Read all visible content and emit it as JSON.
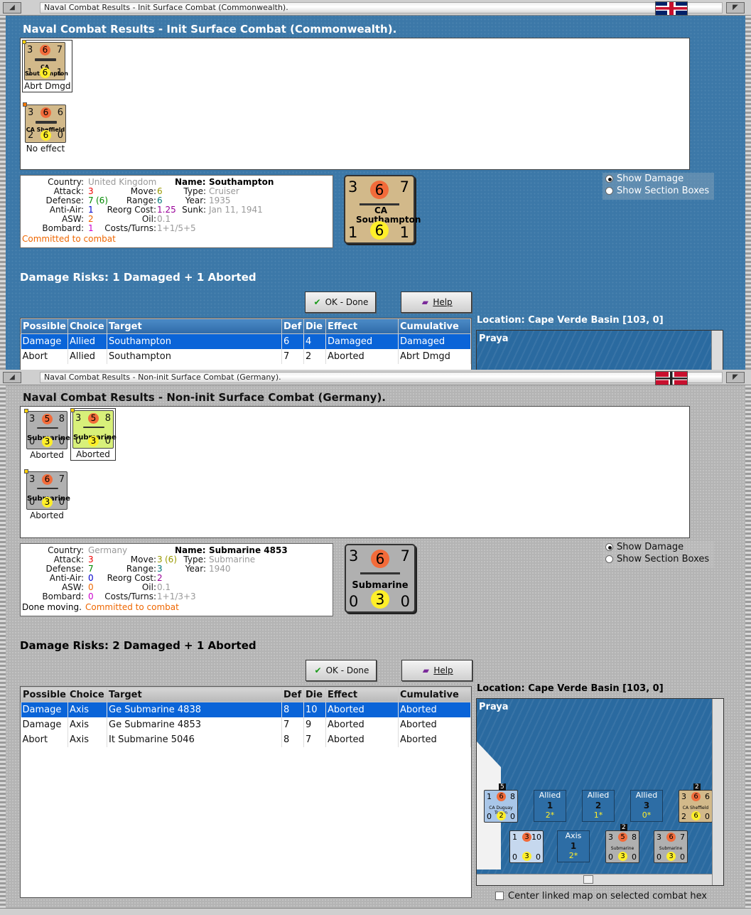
{
  "top": {
    "titlebar": "Naval Combat Results - Init Surface Combat (Commonwealth).",
    "heading": "Naval Combat Results - Init Surface Combat (Commonwealth).",
    "units": [
      {
        "tl": "3",
        "tc": "6",
        "tr": "7",
        "name": "CA Southampton",
        "bl": "1",
        "bc": "6",
        "br": "1",
        "label": "Abrt Dmgd"
      },
      {
        "tl": "3",
        "tc": "6",
        "tr": "6",
        "name": "CA Sheffield",
        "bl": "2",
        "bc": "6",
        "br": "0",
        "label": "No effect"
      }
    ],
    "info": {
      "country_label": "Country:",
      "country": "United Kingdom",
      "attack_label": "Attack:",
      "attack": "3",
      "defense_label": "Defense:",
      "defense": "7",
      "defense_extra": "(6)",
      "antiair_label": "Anti-Air:",
      "antiair": "1",
      "asw_label": "ASW:",
      "asw": "2",
      "bombard_label": "Bombard:",
      "bombard": "1",
      "status": "Committed to combat",
      "name_label": "Name:",
      "name": "Southampton",
      "move_label": "Move:",
      "move": "6",
      "type_label": "Type:",
      "type": "Cruiser",
      "range_label": "Range:",
      "range": "6",
      "year_label": "Year:",
      "year": "1935",
      "reorg_label": "Reorg Cost:",
      "reorg": "1.25",
      "sunk_label": "Sunk:",
      "sunk": "Jan 11, 1941",
      "oil_label": "Oil:",
      "oil": "0.1",
      "costs_label": "Costs/Turns:",
      "costs": "1+1/5+5"
    },
    "bigcounter": {
      "tl": "3",
      "tc": "6",
      "tr": "7",
      "name": "CA Southampton",
      "bl": "1",
      "bc": "6",
      "br": "1"
    },
    "radio": {
      "opt1": "Show Damage",
      "opt2": "Show Section Boxes"
    },
    "risks": "Damage Risks:  1 Damaged + 1 Aborted",
    "ok": "OK - Done",
    "help": "Help",
    "table": {
      "headers": [
        "Possible",
        "Choice",
        "Target",
        "Def",
        "Die",
        "Effect",
        "Cumulative"
      ],
      "rows": [
        [
          "Damage",
          "Allied",
          "Southampton",
          "6",
          "4",
          "Damaged",
          "Damaged"
        ],
        [
          "Abort",
          "Allied",
          "Southampton",
          "7",
          "2",
          "Aborted",
          "Abrt Dmgd"
        ]
      ]
    },
    "location": "Location:  Cape Verde Basin [103, 0]",
    "map_place": "Praya"
  },
  "bottom": {
    "titlebar": "Naval Combat Results - Non-init Surface Combat (Germany).",
    "heading": "Naval Combat Results - Non-init Surface Combat (Germany).",
    "units": [
      {
        "tl": "3",
        "tc": "5",
        "tr": "8",
        "name": "Submarine",
        "bl": "0",
        "bc": "3",
        "br": "0",
        "label": "Aborted"
      },
      {
        "tl": "3",
        "tc": "5",
        "tr": "8",
        "name": "Submarine",
        "bl": "0",
        "bc": "3",
        "br": "0",
        "label": "Aborted"
      },
      {
        "tl": "3",
        "tc": "6",
        "tr": "7",
        "name": "Submarine",
        "bl": "0",
        "bc": "3",
        "br": "0",
        "label": "Aborted"
      }
    ],
    "info": {
      "country_label": "Country:",
      "country": "Germany",
      "attack_label": "Attack:",
      "attack": "3",
      "defense_label": "Defense:",
      "defense": "7",
      "antiair_label": "Anti-Air:",
      "antiair": "0",
      "asw_label": "ASW:",
      "asw": "0",
      "bombard_label": "Bombard:",
      "bombard": "0",
      "status1": "Done moving.",
      "status2": "Committed to combat",
      "name_label": "Name:",
      "name": "Submarine 4853",
      "move_label": "Move:",
      "move": "3",
      "move_extra": "(6)",
      "type_label": "Type:",
      "type": "Submarine",
      "range_label": "Range:",
      "range": "3",
      "year_label": "Year:",
      "year": "1940",
      "reorg_label": "Reorg Cost:",
      "reorg": "2",
      "oil_label": "Oil:",
      "oil": "0.1",
      "costs_label": "Costs/Turns:",
      "costs": "1+1/3+3"
    },
    "bigcounter": {
      "tl": "3",
      "tc": "6",
      "tr": "7",
      "name": "Submarine",
      "bl": "0",
      "bc": "3",
      "br": "0"
    },
    "radio": {
      "opt1": "Show Damage",
      "opt2": "Show Section Boxes"
    },
    "risks": "Damage Risks:  2 Damaged + 1 Aborted",
    "ok": "OK - Done",
    "help": "Help",
    "table": {
      "headers": [
        "Possible",
        "Choice",
        "Target",
        "Def",
        "Die",
        "Effect",
        "Cumulative"
      ],
      "rows": [
        [
          "Damage",
          "Axis",
          "Ge Submarine 4838",
          "8",
          "10",
          "Aborted",
          "Aborted"
        ],
        [
          "Damage",
          "Axis",
          "Ge Submarine 4853",
          "7",
          "9",
          "Aborted",
          "Aborted"
        ],
        [
          "Abort",
          "Axis",
          "It Submarine 5046",
          "8",
          "7",
          "Aborted",
          "Aborted"
        ]
      ]
    },
    "location": "Location:  Cape Verde Basin [103, 0]",
    "map_place": "Praya",
    "map": {
      "c1": {
        "stack": "5",
        "tl": "1",
        "tc": "6",
        "tr": "8",
        "name": "CA Duguay Trouin",
        "bl": "0",
        "bc": "2",
        "br": "0"
      },
      "boxes": [
        {
          "side": "Allied",
          "num": "1",
          "val": "2*"
        },
        {
          "side": "Allied",
          "num": "2",
          "val": "1*"
        },
        {
          "side": "Allied",
          "num": "3",
          "val": "0*"
        },
        {
          "side": "Axis",
          "num": "1",
          "val": "2*"
        }
      ],
      "c2": {
        "stack": "2",
        "tl": "3",
        "tc": "6",
        "tr": "6",
        "name": "CA Sheffield",
        "bl": "2",
        "bc": "6",
        "br": "0"
      },
      "c3": {
        "tl": "1",
        "tc": "3",
        "tr": "10",
        "bl": "0",
        "bc": "3",
        "br": "0"
      },
      "c4": {
        "stack": "2",
        "tl": "3",
        "tc": "5",
        "tr": "8",
        "name": "Submarine",
        "bl": "0",
        "bc": "3",
        "br": "0"
      },
      "c5": {
        "tl": "3",
        "tc": "6",
        "tr": "7",
        "name": "Submarine",
        "bl": "0",
        "bc": "3",
        "br": "0"
      }
    },
    "center_check": "Center linked map on selected combat hex"
  },
  "colors": {
    "accent_red": "#f26b3a",
    "accent_yellow": "#ffef2a",
    "selection_blue": "#0a64d8"
  }
}
